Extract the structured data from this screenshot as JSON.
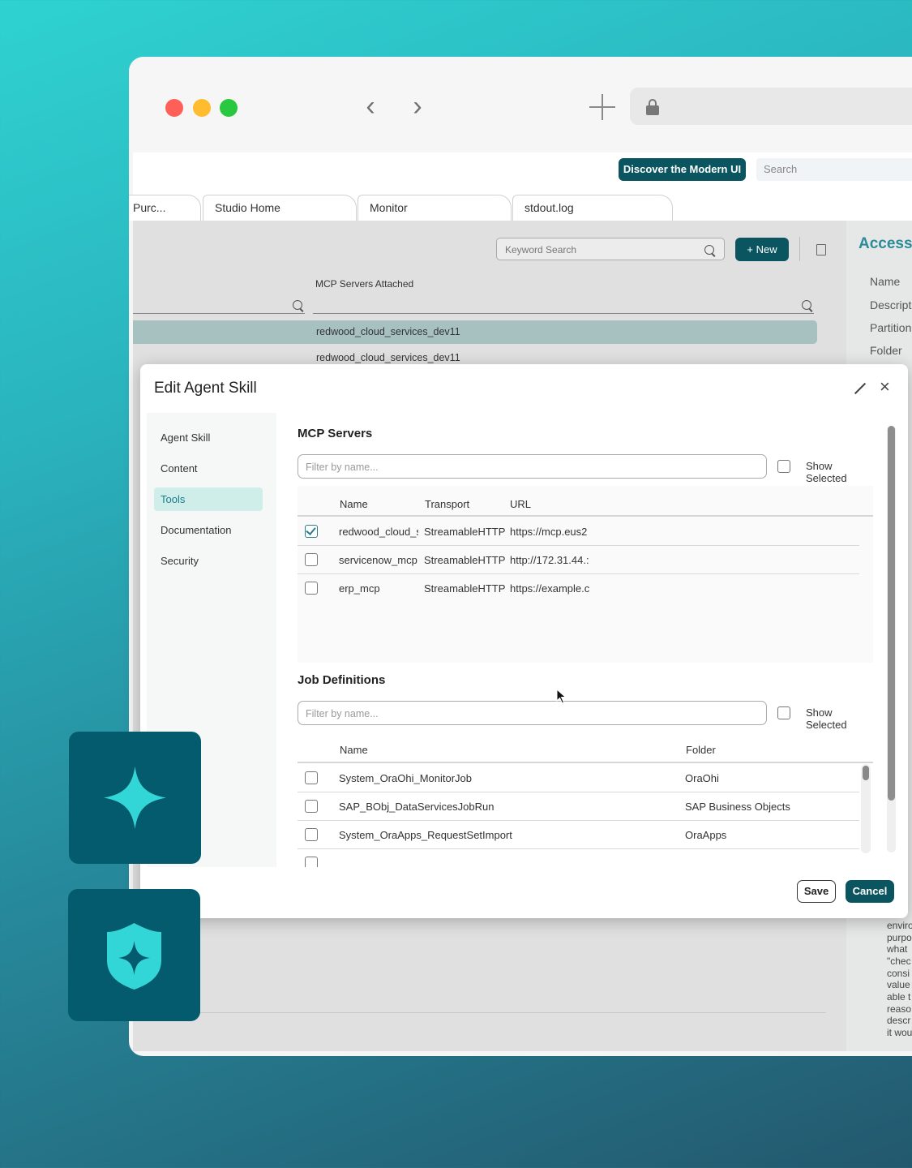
{
  "browser": {
    "nav": {
      "back": "‹",
      "forward": "›"
    },
    "icons": [
      "close-dot",
      "minimize-dot",
      "maximize-dot",
      "back-icon",
      "forward-icon",
      "new-tab-icon",
      "lock-icon"
    ]
  },
  "app": {
    "discover_label": "Discover the Modern UI",
    "search_placeholder": "Search",
    "tabs": [
      {
        "label": "Purc..."
      },
      {
        "label": "Studio Home"
      },
      {
        "label": "Monitor"
      },
      {
        "label": "stdout.log"
      }
    ],
    "toolbar": {
      "keyword_placeholder": "Keyword Search",
      "new_label": "+ New"
    },
    "list": {
      "column_label": "MCP Servers Attached",
      "rows": [
        "redwood_cloud_services_dev11",
        "redwood_cloud_services_dev11"
      ]
    },
    "right_panel": {
      "title": "Access",
      "fields": [
        "Name",
        "Descript",
        "Partition",
        "Folder"
      ],
      "text_lines": [
        "enviro",
        "purpo",
        "what",
        "\"chec",
        "consi",
        "value",
        "able t",
        "reaso",
        "descr",
        "it wou"
      ]
    }
  },
  "modal": {
    "title": "Edit Agent Skill",
    "nav": [
      {
        "label": "Agent Skill",
        "active": false
      },
      {
        "label": "Content",
        "active": false
      },
      {
        "label": "Tools",
        "active": true
      },
      {
        "label": "Documentation",
        "active": false
      },
      {
        "label": "Security",
        "active": false
      }
    ],
    "mcp": {
      "title": "MCP Servers",
      "filter_placeholder": "Filter by name...",
      "show_selected": "Show Selected",
      "columns": [
        "Name",
        "Transport",
        "URL"
      ],
      "rows": [
        {
          "checked": true,
          "name": "redwood_cloud_s",
          "transport": "StreamableHTTP",
          "url": "https://mcp.eus2"
        },
        {
          "checked": false,
          "name": "servicenow_mcp",
          "transport": "StreamableHTTP",
          "url": "http://172.31.44.:"
        },
        {
          "checked": false,
          "name": "erp_mcp",
          "transport": "StreamableHTTP",
          "url": "https://example.c"
        }
      ]
    },
    "jobs": {
      "title": "Job Definitions",
      "filter_placeholder": "Filter by name...",
      "show_selected": "Show Selected",
      "columns": [
        "Name",
        "Folder"
      ],
      "rows": [
        {
          "checked": false,
          "name": "System_OraOhi_MonitorJob",
          "folder": "OraOhi"
        },
        {
          "checked": false,
          "name": "SAP_BObj_DataServicesJobRun",
          "folder": "SAP Business Objects"
        },
        {
          "checked": false,
          "name": "System_OraApps_RequestSetImport",
          "folder": "OraApps"
        }
      ]
    },
    "save_label": "Save",
    "cancel_label": "Cancel"
  },
  "tiles": [
    {
      "icon": "sparkle-icon"
    },
    {
      "icon": "shield-sparkle-icon"
    }
  ],
  "colors": {
    "accent": "#0b5560",
    "tile": "#035b6d",
    "icon_teal": "#33d6d6",
    "active_nav_bg": "#cfeee9"
  }
}
